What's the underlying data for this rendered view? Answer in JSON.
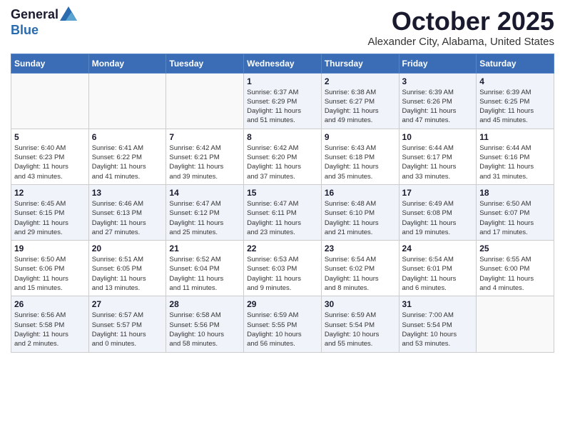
{
  "header": {
    "logo": {
      "line1": "General",
      "line2": "Blue"
    },
    "title": "October 2025",
    "location": "Alexander City, Alabama, United States"
  },
  "weekdays": [
    "Sunday",
    "Monday",
    "Tuesday",
    "Wednesday",
    "Thursday",
    "Friday",
    "Saturday"
  ],
  "weeks": [
    [
      {
        "day": "",
        "info": ""
      },
      {
        "day": "",
        "info": ""
      },
      {
        "day": "",
        "info": ""
      },
      {
        "day": "1",
        "info": "Sunrise: 6:37 AM\nSunset: 6:29 PM\nDaylight: 11 hours\nand 51 minutes."
      },
      {
        "day": "2",
        "info": "Sunrise: 6:38 AM\nSunset: 6:27 PM\nDaylight: 11 hours\nand 49 minutes."
      },
      {
        "day": "3",
        "info": "Sunrise: 6:39 AM\nSunset: 6:26 PM\nDaylight: 11 hours\nand 47 minutes."
      },
      {
        "day": "4",
        "info": "Sunrise: 6:39 AM\nSunset: 6:25 PM\nDaylight: 11 hours\nand 45 minutes."
      }
    ],
    [
      {
        "day": "5",
        "info": "Sunrise: 6:40 AM\nSunset: 6:23 PM\nDaylight: 11 hours\nand 43 minutes."
      },
      {
        "day": "6",
        "info": "Sunrise: 6:41 AM\nSunset: 6:22 PM\nDaylight: 11 hours\nand 41 minutes."
      },
      {
        "day": "7",
        "info": "Sunrise: 6:42 AM\nSunset: 6:21 PM\nDaylight: 11 hours\nand 39 minutes."
      },
      {
        "day": "8",
        "info": "Sunrise: 6:42 AM\nSunset: 6:20 PM\nDaylight: 11 hours\nand 37 minutes."
      },
      {
        "day": "9",
        "info": "Sunrise: 6:43 AM\nSunset: 6:18 PM\nDaylight: 11 hours\nand 35 minutes."
      },
      {
        "day": "10",
        "info": "Sunrise: 6:44 AM\nSunset: 6:17 PM\nDaylight: 11 hours\nand 33 minutes."
      },
      {
        "day": "11",
        "info": "Sunrise: 6:44 AM\nSunset: 6:16 PM\nDaylight: 11 hours\nand 31 minutes."
      }
    ],
    [
      {
        "day": "12",
        "info": "Sunrise: 6:45 AM\nSunset: 6:15 PM\nDaylight: 11 hours\nand 29 minutes."
      },
      {
        "day": "13",
        "info": "Sunrise: 6:46 AM\nSunset: 6:13 PM\nDaylight: 11 hours\nand 27 minutes."
      },
      {
        "day": "14",
        "info": "Sunrise: 6:47 AM\nSunset: 6:12 PM\nDaylight: 11 hours\nand 25 minutes."
      },
      {
        "day": "15",
        "info": "Sunrise: 6:47 AM\nSunset: 6:11 PM\nDaylight: 11 hours\nand 23 minutes."
      },
      {
        "day": "16",
        "info": "Sunrise: 6:48 AM\nSunset: 6:10 PM\nDaylight: 11 hours\nand 21 minutes."
      },
      {
        "day": "17",
        "info": "Sunrise: 6:49 AM\nSunset: 6:08 PM\nDaylight: 11 hours\nand 19 minutes."
      },
      {
        "day": "18",
        "info": "Sunrise: 6:50 AM\nSunset: 6:07 PM\nDaylight: 11 hours\nand 17 minutes."
      }
    ],
    [
      {
        "day": "19",
        "info": "Sunrise: 6:50 AM\nSunset: 6:06 PM\nDaylight: 11 hours\nand 15 minutes."
      },
      {
        "day": "20",
        "info": "Sunrise: 6:51 AM\nSunset: 6:05 PM\nDaylight: 11 hours\nand 13 minutes."
      },
      {
        "day": "21",
        "info": "Sunrise: 6:52 AM\nSunset: 6:04 PM\nDaylight: 11 hours\nand 11 minutes."
      },
      {
        "day": "22",
        "info": "Sunrise: 6:53 AM\nSunset: 6:03 PM\nDaylight: 11 hours\nand 9 minutes."
      },
      {
        "day": "23",
        "info": "Sunrise: 6:54 AM\nSunset: 6:02 PM\nDaylight: 11 hours\nand 8 minutes."
      },
      {
        "day": "24",
        "info": "Sunrise: 6:54 AM\nSunset: 6:01 PM\nDaylight: 11 hours\nand 6 minutes."
      },
      {
        "day": "25",
        "info": "Sunrise: 6:55 AM\nSunset: 6:00 PM\nDaylight: 11 hours\nand 4 minutes."
      }
    ],
    [
      {
        "day": "26",
        "info": "Sunrise: 6:56 AM\nSunset: 5:58 PM\nDaylight: 11 hours\nand 2 minutes."
      },
      {
        "day": "27",
        "info": "Sunrise: 6:57 AM\nSunset: 5:57 PM\nDaylight: 11 hours\nand 0 minutes."
      },
      {
        "day": "28",
        "info": "Sunrise: 6:58 AM\nSunset: 5:56 PM\nDaylight: 10 hours\nand 58 minutes."
      },
      {
        "day": "29",
        "info": "Sunrise: 6:59 AM\nSunset: 5:55 PM\nDaylight: 10 hours\nand 56 minutes."
      },
      {
        "day": "30",
        "info": "Sunrise: 6:59 AM\nSunset: 5:54 PM\nDaylight: 10 hours\nand 55 minutes."
      },
      {
        "day": "31",
        "info": "Sunrise: 7:00 AM\nSunset: 5:54 PM\nDaylight: 10 hours\nand 53 minutes."
      },
      {
        "day": "",
        "info": ""
      }
    ]
  ]
}
